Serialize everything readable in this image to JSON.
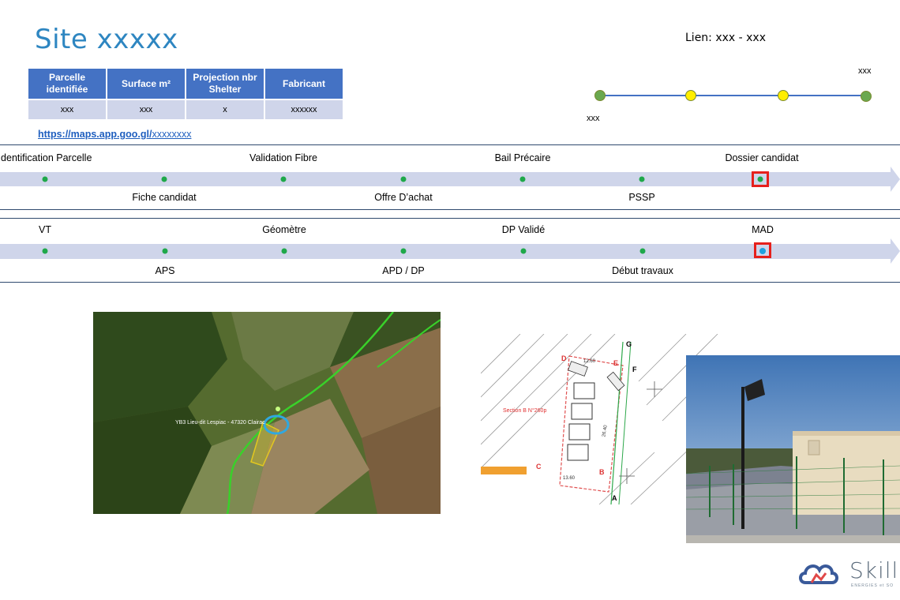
{
  "header": {
    "title": "Site xxxxx",
    "lien": "Lien: xxx - xxx"
  },
  "info_table": {
    "headers": [
      "Parcelle identifiée",
      "Surface m²",
      "Projection nbr Shelter",
      "Fabricant"
    ],
    "values": [
      "xxx",
      "xxx",
      "x",
      "xxxxxx"
    ]
  },
  "maps_link": {
    "bold": "https://maps.app.goo.gl/",
    "rest": "xxxxxxxx"
  },
  "link_diagram": {
    "left_label": "xxx",
    "right_label": "xxx",
    "node_colors": [
      "#6aa84f",
      "#ffee00",
      "#ffee00",
      "#6aa84f"
    ]
  },
  "timeline1": {
    "top_labels": [
      "Identification Parcelle",
      "Validation Fibre",
      "Bail Précaire",
      "Dossier candidat"
    ],
    "bottom_labels": [
      "Fiche candidat",
      "Offre D’achat",
      "PSSP"
    ],
    "current_step": "Dossier candidat"
  },
  "timeline2": {
    "top_labels": [
      "VT",
      "Géomètre",
      "DP Validé",
      "MAD"
    ],
    "bottom_labels": [
      "APS",
      "APD / DP",
      "Début travaux"
    ],
    "current_step": "MAD"
  },
  "map_photo": {
    "parcel_label": "YB3 Lieu-dit Lespiac - 47320 Clairac"
  },
  "plan_drawing": {
    "section_label": "Section B N°260p",
    "letters": [
      "D",
      "E",
      "F",
      "G",
      "C",
      "B",
      "A"
    ],
    "dims": [
      "12.60",
      "13.60",
      "26.40"
    ]
  },
  "logo": {
    "name": "Skill",
    "tagline": "ENERGIES et SO"
  },
  "colors": {
    "accent": "#2e86c1",
    "table_header": "#4472c4",
    "band": "#cfd5ea",
    "highlight": "#e6201c"
  }
}
